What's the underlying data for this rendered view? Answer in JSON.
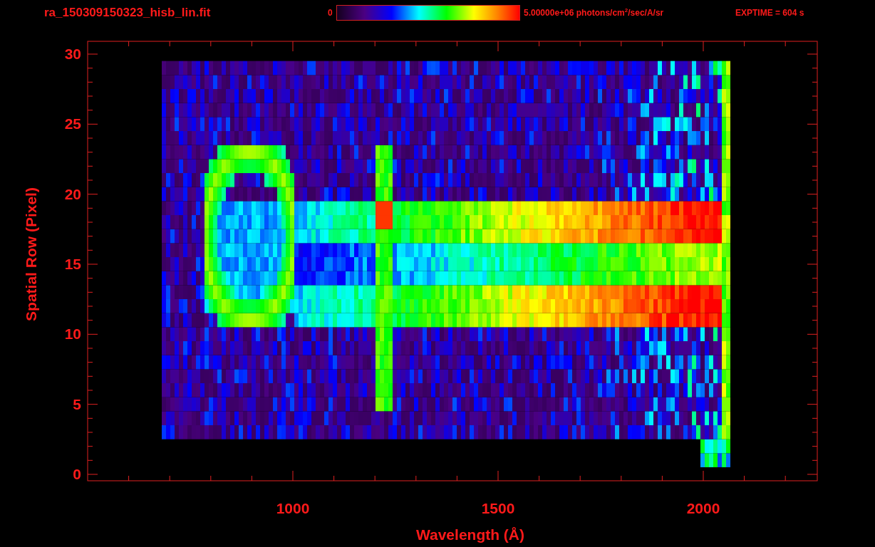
{
  "header": {
    "filename": "ra_150309150323_hisb_lin.fit",
    "colorbar": {
      "min_label": "0",
      "max_label": "5.00000e+06 photons/cm$^{2}$/sec/A/sr"
    },
    "exposure": "EXPTIME = 604 s"
  },
  "plot": {
    "ylabel": "Spatial Row (Pixel)",
    "xlabel": "Wavelength (Å)",
    "xticks": [
      "1000",
      "1500",
      "2000"
    ],
    "yticks": [
      "30",
      "25",
      "20",
      "15",
      "10",
      "5",
      "0"
    ]
  }
}
